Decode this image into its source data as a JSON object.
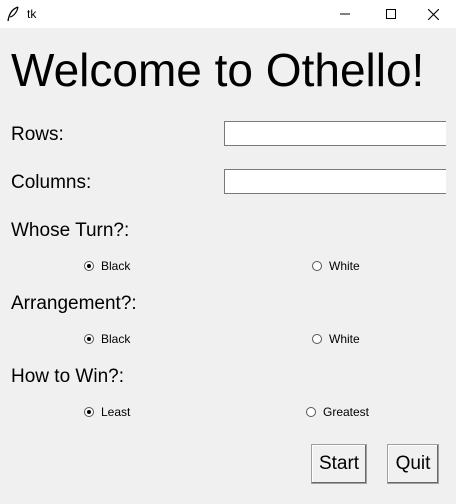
{
  "window": {
    "title": "tk",
    "icon": "feather-icon",
    "controls": [
      "minimize-icon",
      "maximize-icon",
      "close-icon"
    ]
  },
  "heading": "Welcome to Othello!",
  "fields": {
    "rows": {
      "label": "Rows:",
      "value": ""
    },
    "columns": {
      "label": "Columns:",
      "value": ""
    }
  },
  "whose_turn": {
    "label": "Whose Turn?:",
    "options": [
      "Black",
      "White"
    ],
    "selected": "Black"
  },
  "arrangement": {
    "label": "Arrangement?:",
    "options": [
      "Black",
      "White"
    ],
    "selected": "Black"
  },
  "how_to_win": {
    "label": "How to Win?:",
    "options": [
      "Least",
      "Greatest"
    ],
    "selected": "Least"
  },
  "buttons": {
    "start": "Start",
    "quit": "Quit"
  }
}
